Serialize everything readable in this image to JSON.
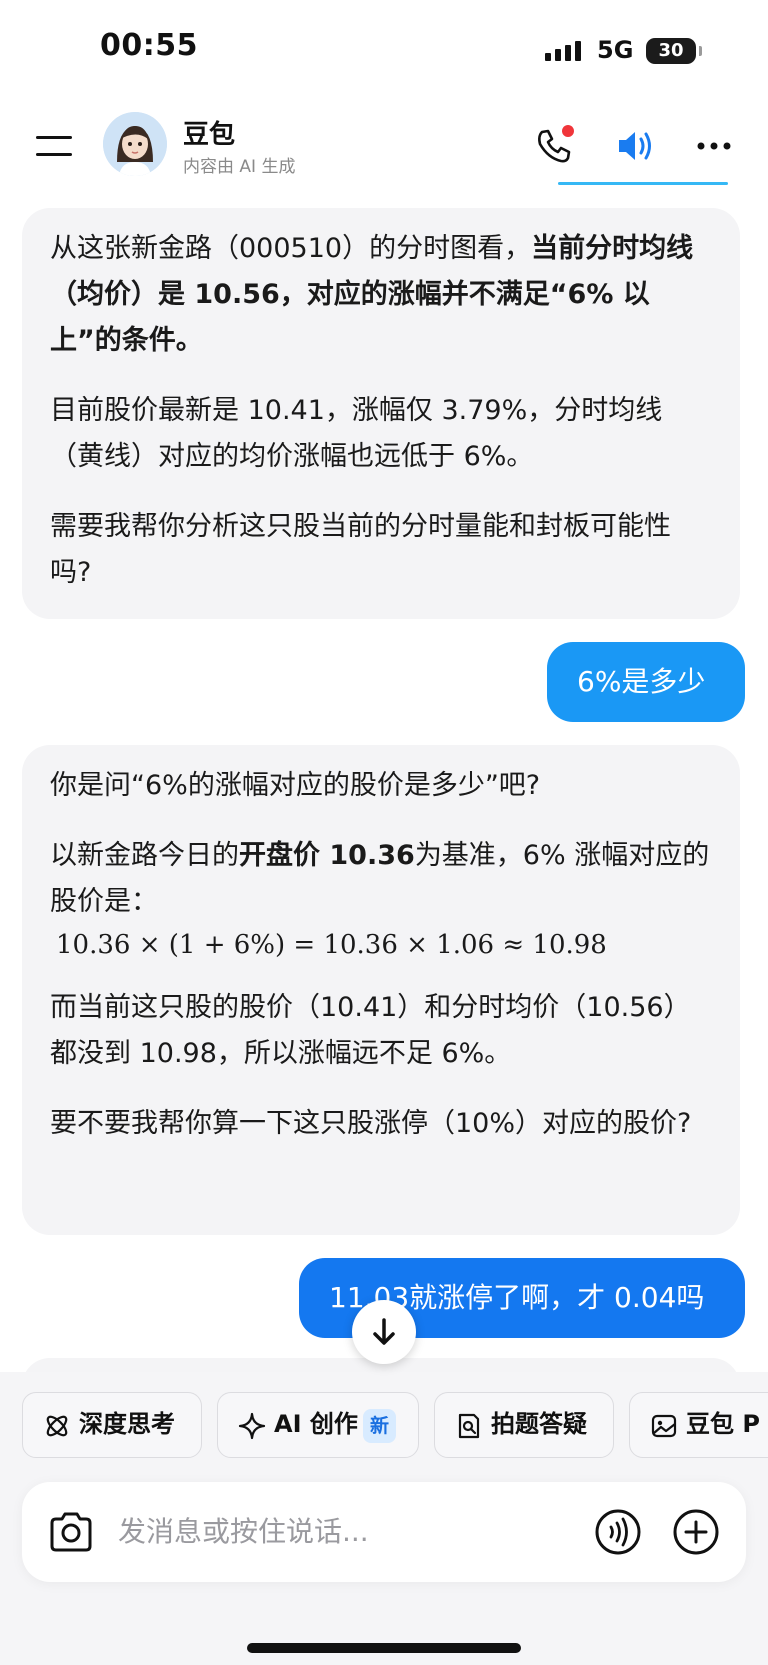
{
  "status_bar": {
    "time": "00:55",
    "network": "5G",
    "battery": "30"
  },
  "header": {
    "title": "豆包",
    "subtitle": "内容由 AI 生成"
  },
  "messages": {
    "bot1": {
      "p1_a": "从这张新金路（000510）的分时图看，",
      "p1_b": "当前分时均线（均价）是 10.56，对应的涨幅并不满足“6% 以上”的条件。",
      "p2": "目前股价最新是 10.41，涨幅仅 3.79%，分时均线（黄线）对应的均价涨幅也远低于 6%。",
      "p3": "需要我帮你分析这只股当前的分时量能和封板可能性吗?"
    },
    "user1": "6%是多少",
    "bot2": {
      "p1": "你是问“6%的涨幅对应的股价是多少”吧?",
      "p2_a": "以新金路今日的",
      "p2_b": "开盘价 10.36",
      "p2_c": "为基准，6% 涨幅对应的股价是：",
      "formula": "10.36 × (1 + 6%) = 10.36 × 1.06 ≈ 10.98",
      "p3": "而当前这只股的股价（10.41）和分时均价（10.56）都没到 10.98，所以涨幅远不足 6%。",
      "p4": "要不要我帮你算一下这只股涨停（10%）对应的股价?"
    },
    "user2": "11.03就涨停了啊，才 0.04吗"
  },
  "chips": [
    {
      "label": "深度思考",
      "icon": "atom-icon"
    },
    {
      "label": "AI 创作",
      "icon": "sparkle-icon",
      "badge": "新"
    },
    {
      "label": "拍题答疑",
      "icon": "photo-question-icon"
    },
    {
      "label": "豆包 P",
      "icon": "image-edit-icon"
    }
  ],
  "input": {
    "placeholder": "发消息或按住说话..."
  },
  "colors": {
    "user_bubble": "#1a98f5",
    "user_bubble_2": "#1478f0",
    "bot_bubble": "#f4f4f6",
    "accent": "#1a7cf0"
  }
}
